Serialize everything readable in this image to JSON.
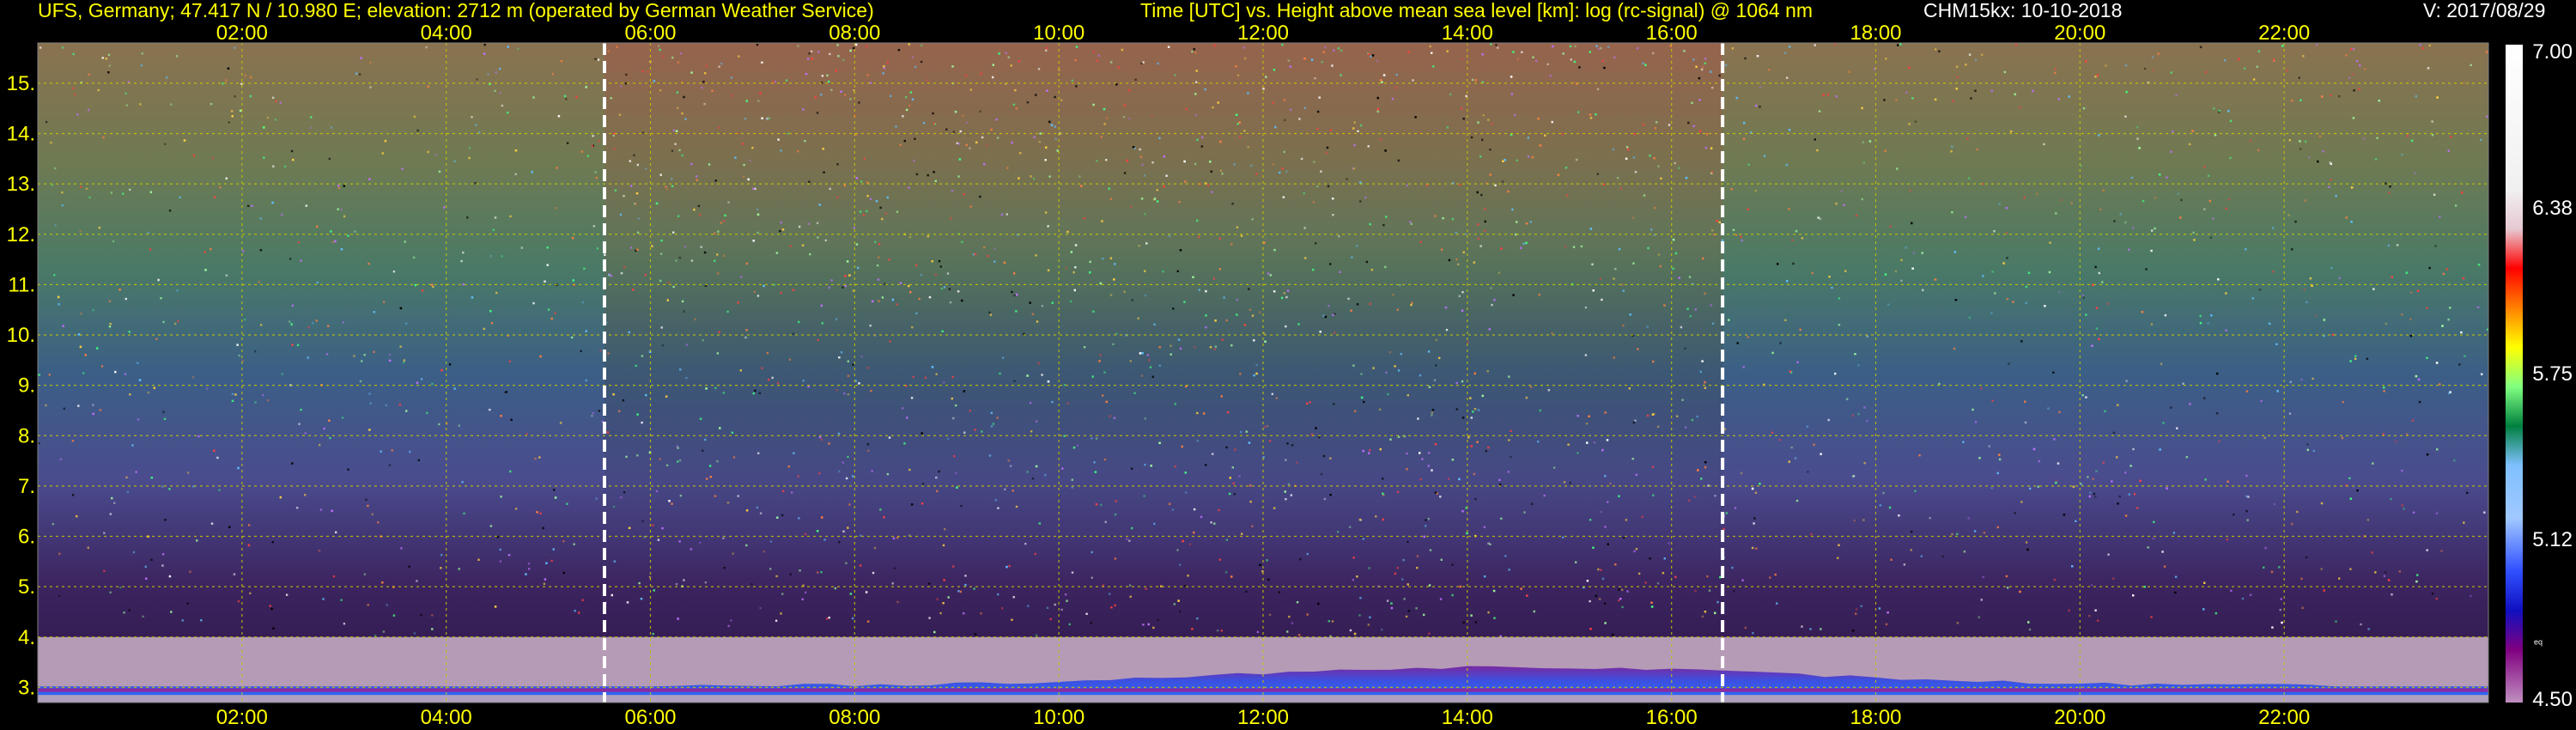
{
  "header": {
    "station": "UFS, Germany; 47.417 N / 10.980 E; elevation: 2712 m  (operated by German Weather Service)",
    "description": "Time [UTC] vs. Height above mean sea level [km]: log (rc-signal) @ 1064 nm",
    "instrument_date": "CHM15kx: 10-10-2018",
    "version": "V: 2017/08/29"
  },
  "colorbar": {
    "tick_labels": [
      "7.00",
      "6.38",
      "5.75",
      "5.12",
      "4.50"
    ],
    "tick_values": [
      7.0,
      6.38,
      5.75,
      5.12,
      4.5
    ],
    "small_label": "eq"
  },
  "colors": {
    "header_text": "#ffff00",
    "grid": "#c8c800",
    "marker": "#ffffff",
    "boundary_layer": "#b59bb6"
  },
  "chart_data": {
    "type": "heatmap",
    "title": "Time [UTC] vs. Height above mean sea level [km]: log (rc-signal) @ 1064 nm",
    "xlabel": "Time [UTC]",
    "ylabel": "Height above mean sea level [km]",
    "x_tick_labels": [
      "02:00",
      "04:00",
      "06:00",
      "08:00",
      "10:00",
      "12:00",
      "14:00",
      "16:00",
      "18:00",
      "20:00",
      "22:00"
    ],
    "x_tick_values": [
      2,
      4,
      6,
      8,
      10,
      12,
      14,
      16,
      18,
      20,
      22
    ],
    "y_tick_labels": [
      "3.",
      "4.",
      "5.",
      "6.",
      "7.",
      "8.",
      "9.",
      "10.",
      "11.",
      "12.",
      "13.",
      "14.",
      "15."
    ],
    "y_tick_values": [
      3,
      4,
      5,
      6,
      7,
      8,
      9,
      10,
      11,
      12,
      13,
      14,
      15
    ],
    "xlim": [
      0,
      24
    ],
    "ylim": [
      2.7,
      15.8
    ],
    "colorbar_range": [
      4.5,
      7.0
    ],
    "grid": true,
    "sunrise_sunset_markers_utc": [
      5.55,
      16.5
    ]
  }
}
